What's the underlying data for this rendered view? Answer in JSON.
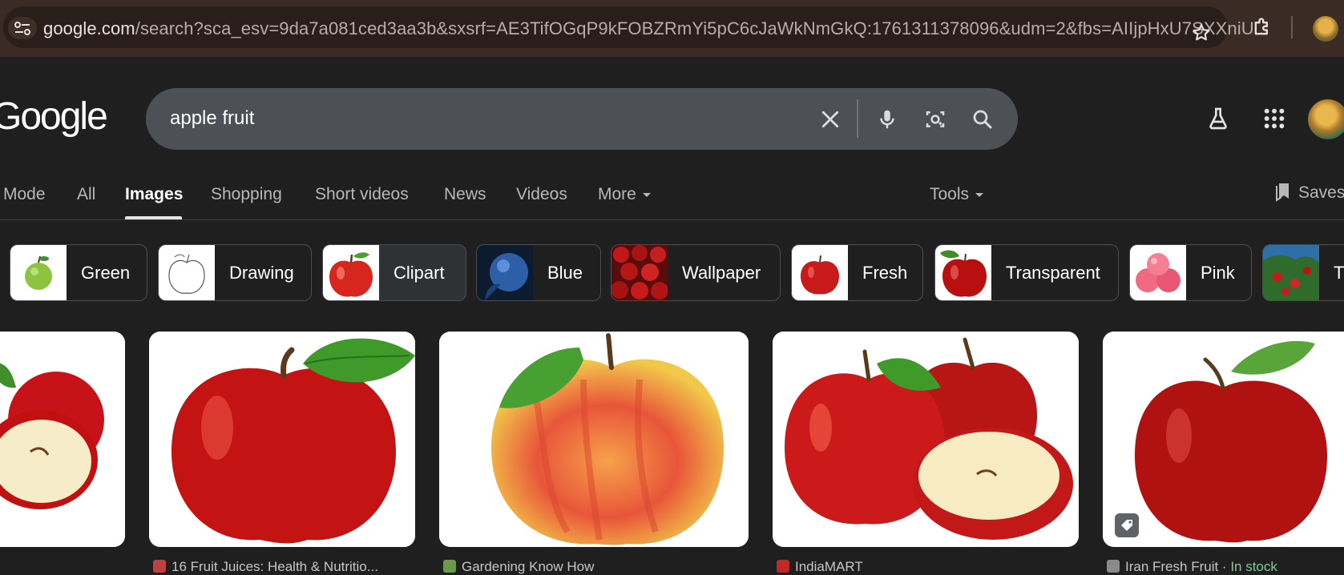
{
  "browser": {
    "url_host": "google.com",
    "url_path": "/search?sca_esv=9da7a081ced3aa3b&sxsrf=AE3TifOGqP9kFOBZRmYi5pC6cJaWkNmGkQ:1761311378096&udm=2&fbs=AIIjpHxU7SXXniU..."
  },
  "header": {
    "logo": "Google",
    "query": "apple fruit"
  },
  "tabs": [
    {
      "label": "Mode"
    },
    {
      "label": "All"
    },
    {
      "label": "Images"
    },
    {
      "label": "Shopping"
    },
    {
      "label": "Short videos"
    },
    {
      "label": "News"
    },
    {
      "label": "Videos"
    },
    {
      "label": "More"
    },
    {
      "label": "Tools"
    },
    {
      "label": "Saves"
    }
  ],
  "chips": [
    {
      "label": "Green"
    },
    {
      "label": "Drawing"
    },
    {
      "label": "Clipart"
    },
    {
      "label": "Blue"
    },
    {
      "label": "Wallpaper"
    },
    {
      "label": "Fresh"
    },
    {
      "label": "Transparent"
    },
    {
      "label": "Pink"
    },
    {
      "label": "Tr"
    }
  ],
  "results": [
    {
      "source": ""
    },
    {
      "source": "16 Fruit Juices: Health & Nutritio..."
    },
    {
      "source": "Gardening Know How"
    },
    {
      "source": "IndiaMART"
    },
    {
      "source": "Iran Fresh Fruit",
      "separator": " · ",
      "status": "In stock"
    }
  ],
  "colors": {
    "background": "#1f1f1f",
    "search_box": "#4d5156",
    "browser_frame": "#3a2b25",
    "in_stock": "#81c995"
  }
}
